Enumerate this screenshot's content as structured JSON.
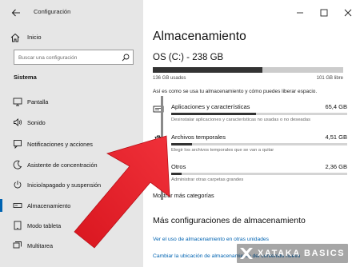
{
  "window": {
    "app_title": "Configuración"
  },
  "sidebar": {
    "home_label": "Inicio",
    "search_placeholder": "Buscar una configuración",
    "section_label": "Sistema",
    "items": [
      {
        "label": "Pantalla",
        "icon": "monitor-icon"
      },
      {
        "label": "Sonido",
        "icon": "speaker-icon"
      },
      {
        "label": "Notificaciones y acciones",
        "icon": "notification-icon"
      },
      {
        "label": "Asistente de concentración",
        "icon": "moon-icon"
      },
      {
        "label": "Inicio/apagado y suspensión",
        "icon": "power-icon"
      },
      {
        "label": "Almacenamiento",
        "icon": "drive-icon",
        "active": true
      },
      {
        "label": "Modo tableta",
        "icon": "tablet-icon"
      },
      {
        "label": "Multitarea",
        "icon": "multitask-icon"
      }
    ]
  },
  "main": {
    "title": "Almacenamiento",
    "drive": "OS (C:) - 238 GB",
    "usage": {
      "used_label": "136 GB usados",
      "free_label": "101 GB libre",
      "used_fraction": 0.574
    },
    "description": "Así es como se usa tu almacenamiento y cómo puedes liberar espacio.",
    "categories": [
      {
        "name": "Aplicaciones y características",
        "size": "65,4 GB",
        "sub": "Desinstalar aplicaciones y características no usadas o no deseadas",
        "fraction": 0.48,
        "icon": "apps-icon"
      },
      {
        "name": "Archivos temporales",
        "size": "4,51 GB",
        "sub": "Elegir los archivos temporales que se van a quitar",
        "fraction": 0.12,
        "icon": "trash-icon"
      },
      {
        "name": "Otros",
        "size": "2,36 GB",
        "sub": "Administrar otras carpetas grandes",
        "fraction": 0.06,
        "icon": "folder-icon"
      }
    ],
    "more_categories": "Mostrar más categorías",
    "section2_title": "Más configuraciones de almacenamiento",
    "link1": "Ver el uso de almacenamiento en otras unidades",
    "link2": "Cambiar la ubicación de almacenamiento del contenido nuevo"
  },
  "watermark": {
    "text": "XATAKA BASICS"
  },
  "colors": {
    "sidebar_bg": "#e6e6e6",
    "accent": "#0063b1",
    "arrow": "#e8202a"
  }
}
